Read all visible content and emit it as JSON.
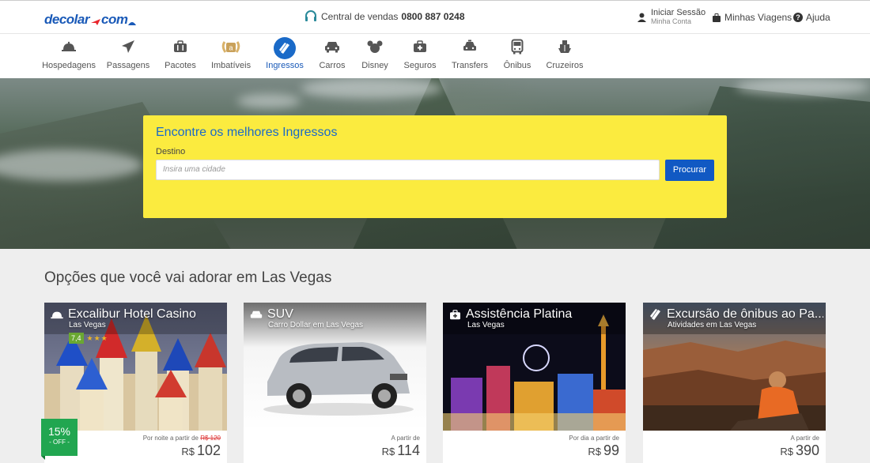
{
  "header": {
    "logo_text": "decolar",
    "logo_com": "com",
    "sales_label": "Central de vendas",
    "sales_number": "0800 887 0248",
    "login_label": "Iniciar Sessão",
    "login_sub": "Minha Conta",
    "trips_label": "Minhas Viagens",
    "help_label": "Ajuda"
  },
  "nav": {
    "items": [
      {
        "label": "Hospedagens",
        "icon": "bell-icon"
      },
      {
        "label": "Passagens",
        "icon": "plane-icon"
      },
      {
        "label": "Pacotes",
        "icon": "suitcase-icon"
      },
      {
        "label": "Imbatíveis",
        "icon": "wreath-icon"
      },
      {
        "label": "Ingressos",
        "icon": "ticket-icon"
      },
      {
        "label": "Carros",
        "icon": "car-icon"
      },
      {
        "label": "Disney",
        "icon": "mickey-icon"
      },
      {
        "label": "Seguros",
        "icon": "medical-kit-icon"
      },
      {
        "label": "Transfers",
        "icon": "transfer-car-icon"
      },
      {
        "label": "Ônibus",
        "icon": "bus-icon"
      },
      {
        "label": "Cruzeiros",
        "icon": "ship-icon"
      }
    ],
    "active": "Ingressos"
  },
  "search": {
    "title": "Encontre os melhores Ingressos",
    "destination_label": "Destino",
    "destination_placeholder": "Insira uma cidade",
    "button": "Procurar"
  },
  "section": {
    "title": "Opções que você vai adorar em Las Vegas"
  },
  "cards": [
    {
      "title": "Excalibur Hotel Casino",
      "subtitle": "Las Vegas",
      "icon": "bell-icon",
      "rating": "7,4",
      "stars": "★★★",
      "price_label": "Por noite a partir de",
      "old_price": "R$ 120",
      "currency": "R$",
      "price": "102",
      "discount": "15%",
      "discount_label": "- OFF -"
    },
    {
      "title": "SUV",
      "subtitle": "Carro Dollar em Las Vegas",
      "icon": "car-icon",
      "price_label": "A partir de",
      "currency": "R$",
      "price": "114"
    },
    {
      "title": "Assistência Platina",
      "subtitle": "Las Vegas",
      "icon": "medical-kit-icon",
      "price_label": "Por dia a partir de",
      "currency": "R$",
      "price": "99"
    },
    {
      "title": "Excursão de ônibus ao Pa...",
      "subtitle": "Atividades em Las Vegas",
      "icon": "ticket-icon",
      "price_label": "A partir de",
      "currency": "R$",
      "price": "390"
    }
  ],
  "colors": {
    "brand_blue": "#1a5ab8",
    "search_yellow": "#fbeb3f",
    "button_blue": "#1159c3",
    "discount_green": "#21a650"
  }
}
